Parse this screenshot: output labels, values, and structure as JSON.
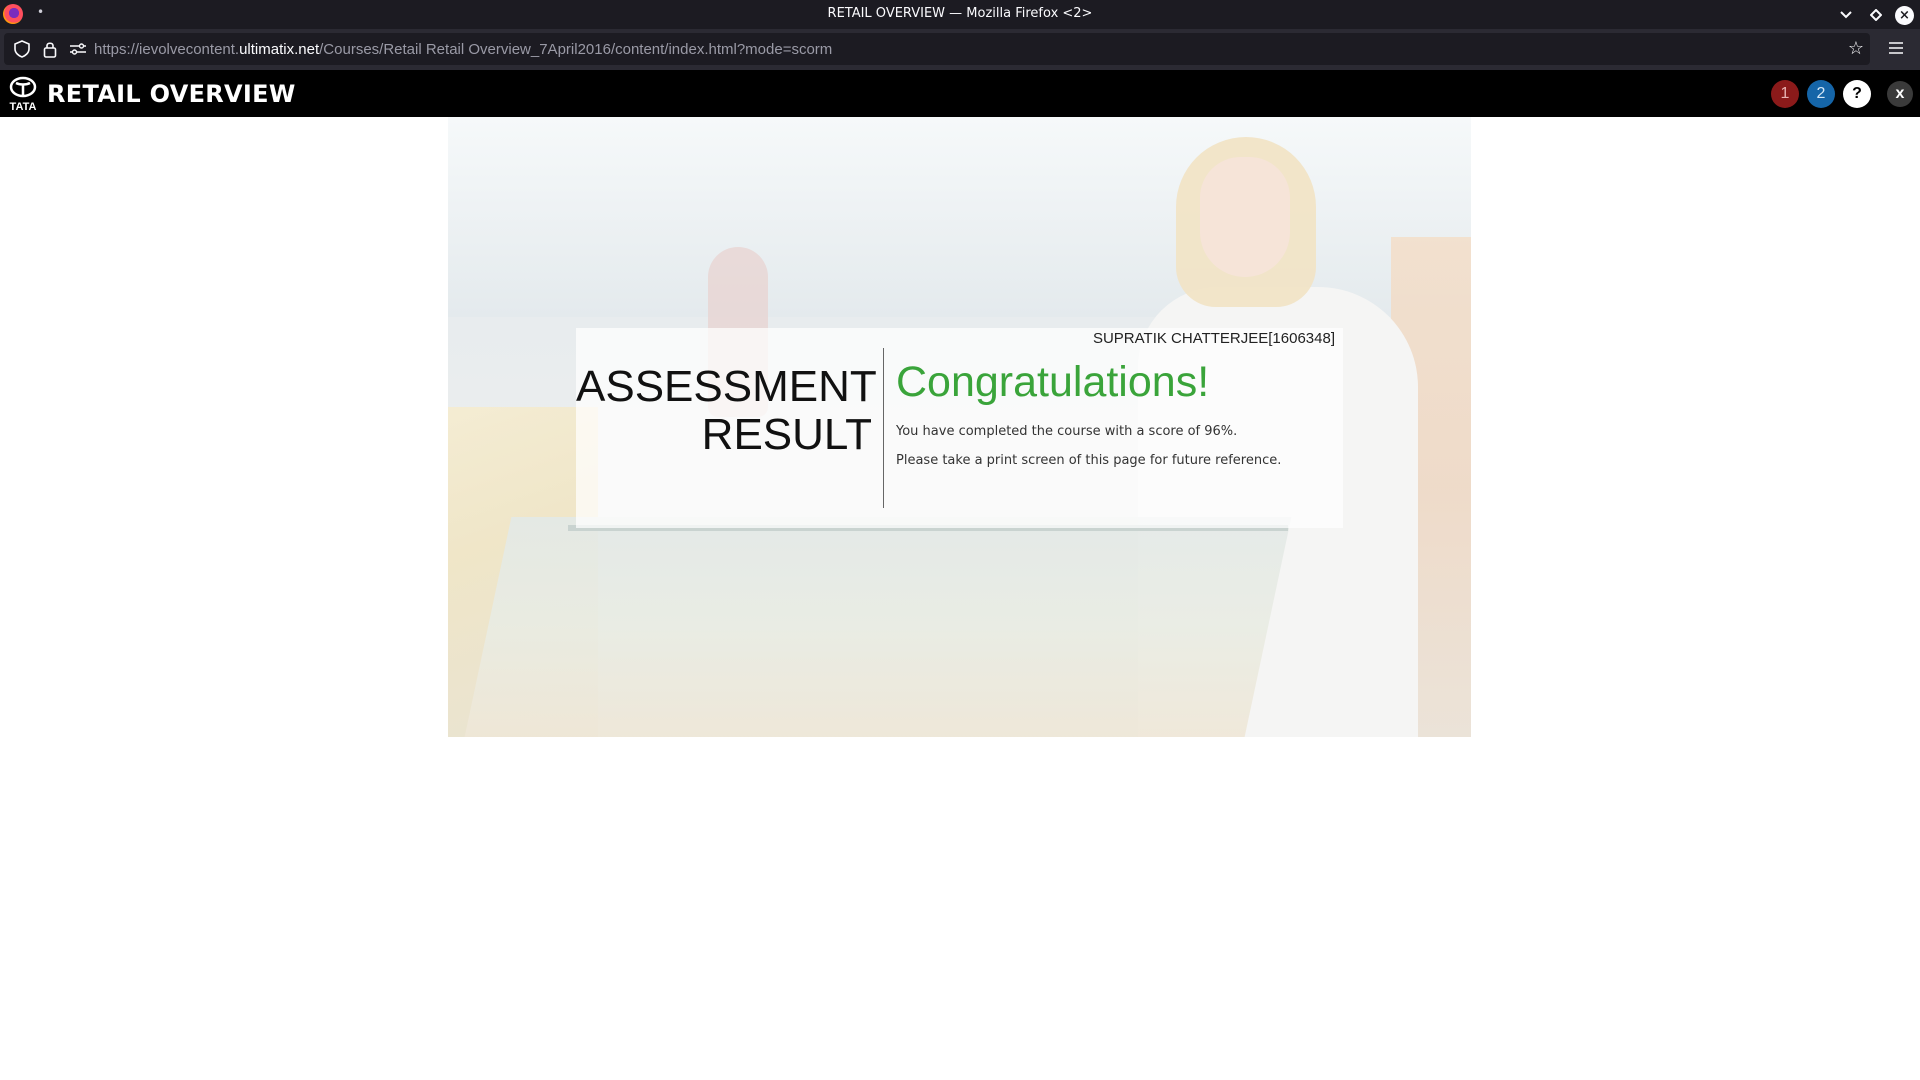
{
  "window": {
    "title": "RETAIL OVERVIEW — Mozilla Firefox <2>",
    "menu_glyph": "•"
  },
  "browser": {
    "url_prefix": "https://ievolvecontent.",
    "url_host": "ultimatix.net",
    "url_path": "/Courses/Retail Retail Overview_7April2016/content/index.html?mode=scorm"
  },
  "course": {
    "title": "RETAIL OVERVIEW",
    "logo_text": "TATA",
    "header_buttons": [
      {
        "label": "1",
        "color": "#8b1a1a"
      },
      {
        "label": "2",
        "color": "#1565a8"
      },
      {
        "label": "?",
        "color": "#ffffff"
      },
      {
        "label": "x",
        "color": "#3a3a3a"
      }
    ]
  },
  "result": {
    "user": "SUPRATIK CHATTERJEE[1606348]",
    "heading_line1": "ASSESSMENT",
    "heading_line2": "RESULT",
    "congrats": "Congratulations!",
    "message1": "You have completed the course with a score of 96%.",
    "message2": "Please take a print screen of this page for future reference.",
    "accent_color": "#3aa43a"
  }
}
